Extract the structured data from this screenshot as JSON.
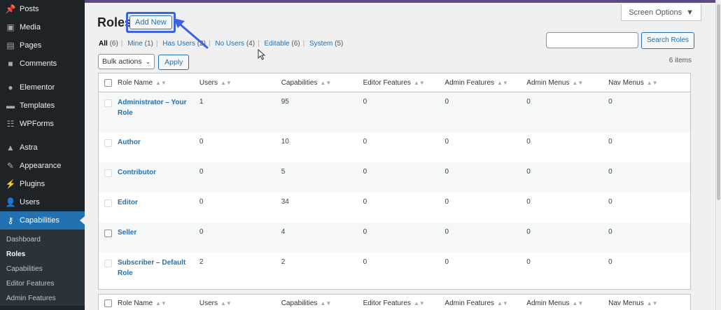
{
  "sidebar": {
    "menu": [
      {
        "label": "Posts",
        "icon": "pin-icon"
      },
      {
        "label": "Media",
        "icon": "media-icon"
      },
      {
        "label": "Pages",
        "icon": "pages-icon"
      },
      {
        "label": "Comments",
        "icon": "comments-icon"
      },
      {
        "label": "Elementor",
        "icon": "elementor-icon"
      },
      {
        "label": "Templates",
        "icon": "folder-icon"
      },
      {
        "label": "WPForms",
        "icon": "forms-icon"
      },
      {
        "label": "Astra",
        "icon": "astra-icon"
      },
      {
        "label": "Appearance",
        "icon": "brush-icon"
      },
      {
        "label": "Plugins",
        "icon": "plugin-icon"
      },
      {
        "label": "Users",
        "icon": "user-icon"
      },
      {
        "label": "Capabilities",
        "icon": "key-icon"
      }
    ],
    "submenu": [
      "Dashboard",
      "Roles",
      "Capabilities",
      "Editor Features",
      "Admin Features"
    ]
  },
  "header": {
    "screen_options": "Screen Options",
    "title": "Roles",
    "add_new": "Add New"
  },
  "filters": {
    "all": "All",
    "all_count": "(6)",
    "mine": "Mine",
    "mine_count": "(1)",
    "has_users": "Has Users",
    "has_users_count": "(2)",
    "no_users": "No Users",
    "no_users_count": "(4)",
    "editable": "Editable",
    "editable_count": "(6)",
    "system": "System",
    "system_count": "(5)"
  },
  "search": {
    "button": "Search Roles",
    "value": ""
  },
  "bulk": {
    "selected": "Bulk actions",
    "apply": "Apply"
  },
  "items_count": "6 items",
  "table": {
    "columns": [
      "Role Name",
      "Users",
      "Capabilities",
      "Editor Features",
      "Admin Features",
      "Admin Menus",
      "Nav Menus"
    ],
    "rows": [
      {
        "name": "Administrator – Your Role",
        "users": "1",
        "caps": "95",
        "editor": "0",
        "admin": "0",
        "menus": "0",
        "nav": "0"
      },
      {
        "name": "Author",
        "users": "0",
        "caps": "10",
        "editor": "0",
        "admin": "0",
        "menus": "0",
        "nav": "0"
      },
      {
        "name": "Contributor",
        "users": "0",
        "caps": "5",
        "editor": "0",
        "admin": "0",
        "menus": "0",
        "nav": "0"
      },
      {
        "name": "Editor",
        "users": "0",
        "caps": "34",
        "editor": "0",
        "admin": "0",
        "menus": "0",
        "nav": "0"
      },
      {
        "name": "Seller",
        "users": "0",
        "caps": "4",
        "editor": "0",
        "admin": "0",
        "menus": "0",
        "nav": "0"
      },
      {
        "name": "Subscriber – Default Role",
        "users": "2",
        "caps": "2",
        "editor": "0",
        "admin": "0",
        "menus": "0",
        "nav": "0"
      }
    ]
  },
  "colors": {
    "sidebar": "#1d2327",
    "accent": "#2271b1",
    "highlight": "#3d63e0"
  }
}
